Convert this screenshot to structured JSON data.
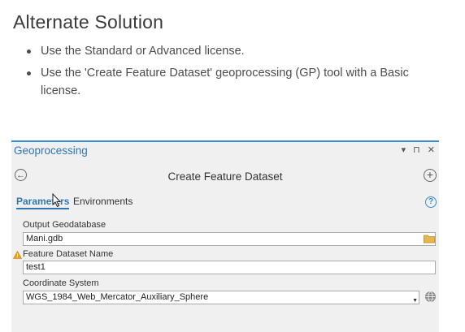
{
  "article": {
    "heading": "Alternate Solution",
    "bullets": [
      "Use the Standard or Advanced license.",
      "Use the 'Create Feature Dataset' geoprocessing (GP) tool with a Basic license."
    ]
  },
  "pane": {
    "title": "Geoprocessing",
    "window_controls": "▾ ⊓ ✕",
    "tool_title": "Create Feature Dataset",
    "tabs": [
      {
        "label": "Parameters",
        "active": true
      },
      {
        "label": "Environments",
        "active": false
      }
    ],
    "fields": {
      "output_gdb": {
        "label": "Output Geodatabase",
        "value": "Mani.gdb"
      },
      "dataset_name": {
        "label": "Feature Dataset Name",
        "value": "test1"
      },
      "coord_system": {
        "label": "Coordinate System",
        "value": "WGS_1984_Web_Mercator_Auxiliary_Sphere"
      }
    }
  },
  "icons": [
    "back-arrow-icon",
    "add-icon",
    "help-icon",
    "warning-icon",
    "folder-icon",
    "dropdown-arrow-icon",
    "globe-icon",
    "mouse-cursor-icon"
  ],
  "colors": {
    "accent": "#2f76b5",
    "pane_bg": "#f0f0f0",
    "warning": "#f0a020",
    "folder": "#e8b64b"
  }
}
